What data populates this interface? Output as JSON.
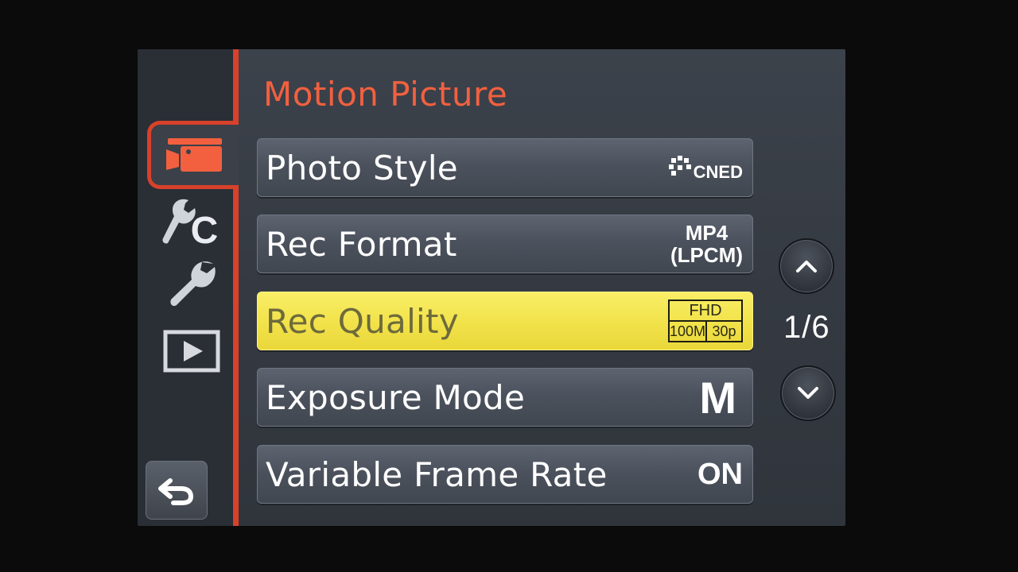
{
  "header": {
    "title": "Motion Picture"
  },
  "sidebar": {
    "tabs": [
      {
        "name": "motion-picture",
        "icon": "video-camera-icon",
        "active": true
      },
      {
        "name": "custom",
        "icon": "custom-wrench-icon",
        "label": "C"
      },
      {
        "name": "setup",
        "icon": "wrench-icon"
      },
      {
        "name": "playback",
        "icon": "playback-icon"
      }
    ],
    "back_icon": "return-arrow-icon"
  },
  "menu": {
    "items": [
      {
        "label": "Photo Style",
        "value": "CNED",
        "value_icon": "photo-style-icon"
      },
      {
        "label": "Rec Format",
        "value_line1": "MP4",
        "value_line2": "(LPCM)"
      },
      {
        "label": "Rec Quality",
        "value_top": "FHD",
        "value_left": "100M",
        "value_right": "30p",
        "selected": true
      },
      {
        "label": "Exposure Mode",
        "value": "M"
      },
      {
        "label": "Variable Frame Rate",
        "value": "ON"
      }
    ]
  },
  "pagination": {
    "page_text": "1/6",
    "up_icon": "chevron-up-icon",
    "down_icon": "chevron-down-icon"
  },
  "colors": {
    "accent": "#d8412a",
    "title": "#f2603f",
    "selected": "#f2e24a"
  }
}
